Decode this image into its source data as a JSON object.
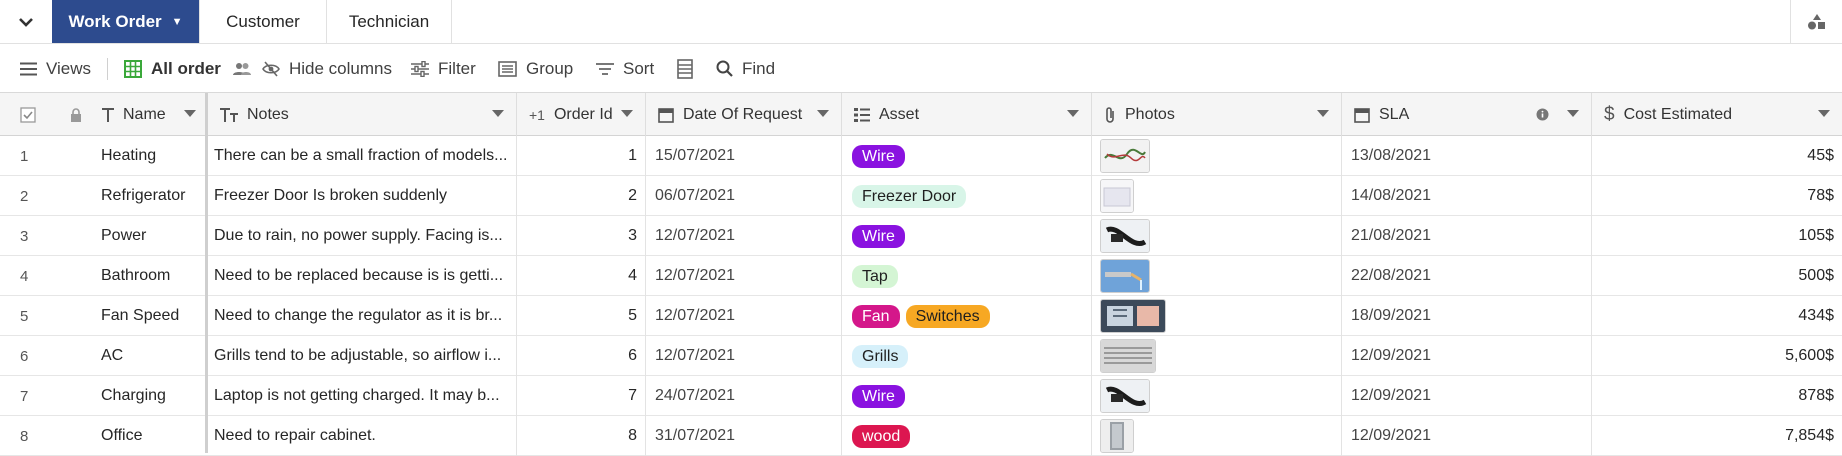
{
  "tabs": {
    "active": "Work Order",
    "customer": "Customer",
    "technician": "Technician"
  },
  "toolbar": {
    "views": "Views",
    "view_name": "All order",
    "hide_columns": "Hide columns",
    "filter": "Filter",
    "group": "Group",
    "sort": "Sort",
    "find": "Find"
  },
  "columns": {
    "name": "Name",
    "notes": "Notes",
    "order_id": "Order Id",
    "date": "Date Of Request",
    "asset": "Asset",
    "photos": "Photos",
    "sla": "SLA",
    "cost": "Cost Estimated"
  },
  "colors": {
    "tab_active": "#2d4b8e",
    "purple": "#8a12e0",
    "pink": "#d4178a",
    "orange": "#f7a823",
    "red": "#dc1650",
    "green_light": "#d4f5d4",
    "mint_light": "#d8f5e8",
    "blue_light": "#d6f0fa"
  },
  "rows": [
    {
      "n": "1",
      "name": "Heating",
      "notes": "There can be a small fraction of models...",
      "order_id": "1",
      "date": "15/07/2021",
      "assets": [
        {
          "label": "Wire",
          "bg": "#8a12e0",
          "fg": "#fff"
        }
      ],
      "photo": "wire-photo",
      "sla": "13/08/2021",
      "cost": "45$"
    },
    {
      "n": "2",
      "name": "Refrigerator",
      "notes": "Freezer Door Is broken suddenly",
      "order_id": "2",
      "date": "06/07/2021",
      "assets": [
        {
          "label": "Freezer Door",
          "bg": "#d8f5e8",
          "fg": "#1f1f1f"
        }
      ],
      "photo": "freezer-photo",
      "sla": "14/08/2021",
      "cost": "78$"
    },
    {
      "n": "3",
      "name": "Power",
      "notes": "Due to rain, no power supply. Facing is...",
      "order_id": "3",
      "date": "12/07/2021",
      "assets": [
        {
          "label": "Wire",
          "bg": "#8a12e0",
          "fg": "#fff"
        }
      ],
      "photo": "cable-photo",
      "sla": "21/08/2021",
      "cost": "105$"
    },
    {
      "n": "4",
      "name": "Bathroom",
      "notes": "Need to be replaced because is is getti...",
      "order_id": "4",
      "date": "12/07/2021",
      "assets": [
        {
          "label": "Tap",
          "bg": "#d4f5d4",
          "fg": "#1f1f1f"
        }
      ],
      "photo": "tap-photo",
      "sla": "22/08/2021",
      "cost": "500$"
    },
    {
      "n": "5",
      "name": "Fan Speed",
      "notes": "Need to change the regulator as it is br...",
      "order_id": "5",
      "date": "12/07/2021",
      "assets": [
        {
          "label": "Fan",
          "bg": "#d4178a",
          "fg": "#fff"
        },
        {
          "label": "Switches",
          "bg": "#f7a823",
          "fg": "#1f1f1f"
        }
      ],
      "photo": "switch-photo",
      "sla": "18/09/2021",
      "cost": "434$"
    },
    {
      "n": "6",
      "name": "AC",
      "notes": "Grills tend to be adjustable, so airflow i...",
      "order_id": "6",
      "date": "12/07/2021",
      "assets": [
        {
          "label": "Grills",
          "bg": "#d6f0fa",
          "fg": "#1f1f1f"
        }
      ],
      "photo": "grill-photo",
      "sla": "12/09/2021",
      "cost": "5,600$"
    },
    {
      "n": "7",
      "name": "Charging",
      "notes": "Laptop is not getting charged. It may b...",
      "order_id": "7",
      "date": "24/07/2021",
      "assets": [
        {
          "label": "Wire",
          "bg": "#8a12e0",
          "fg": "#fff"
        }
      ],
      "photo": "cable-photo",
      "sla": "12/09/2021",
      "cost": "878$"
    },
    {
      "n": "8",
      "name": "Office",
      "notes": "Need to repair cabinet.",
      "order_id": "8",
      "date": "31/07/2021",
      "assets": [
        {
          "label": "wood",
          "bg": "#dc1650",
          "fg": "#fff"
        }
      ],
      "photo": "cabinet-photo",
      "sla": "12/09/2021",
      "cost": "7,854$"
    }
  ]
}
